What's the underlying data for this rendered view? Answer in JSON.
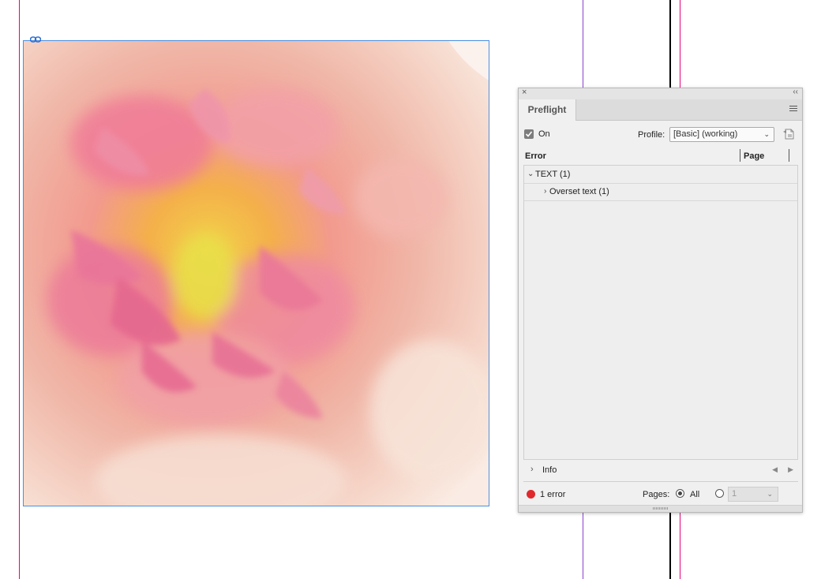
{
  "colors": {
    "panel_bg": "#f0f0f0",
    "error_red": "#e0292d",
    "frame_blue": "#4a8fe0",
    "guide_magenta": "#e6007e",
    "guide_purple": "#8a3fd0",
    "guide_black": "#000000"
  },
  "canvas": {
    "image_description_icon": "link-chain-icon"
  },
  "panel": {
    "close_glyph": "×",
    "collapse_glyph": "‹‹",
    "tab_label": "Preflight",
    "on_label": "On",
    "on_checked": true,
    "profile_label": "Profile:",
    "profile_value": "[Basic] (working)",
    "columns": {
      "error": "Error",
      "page": "Page"
    },
    "rows": [
      {
        "label": "TEXT (1)",
        "expanded": true
      },
      {
        "label": "Overset text (1)",
        "expanded": false
      }
    ],
    "info_label": "Info",
    "status_text": "1 error",
    "pages_label": "Pages:",
    "all_label": "All",
    "page_field_value": "1"
  }
}
